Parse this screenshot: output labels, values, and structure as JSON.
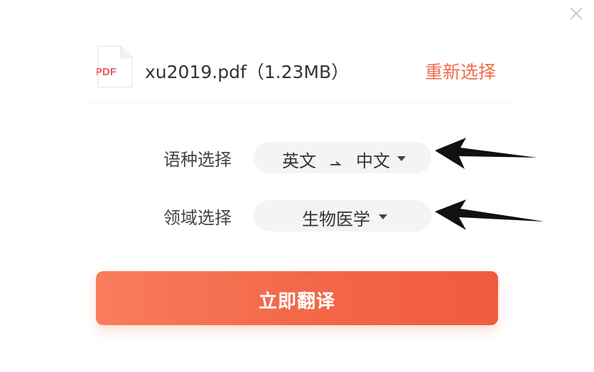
{
  "file": {
    "type_badge": "PDF",
    "name_with_size": "xu2019.pdf（1.23MB）",
    "reselect_label": "重新选择"
  },
  "form": {
    "language": {
      "label": "语种选择",
      "source": "英文",
      "target": "中文"
    },
    "domain": {
      "label": "领域选择",
      "value": "生物医学"
    }
  },
  "actions": {
    "translate_label": "立即翻译"
  },
  "icons": {
    "close": "close-icon",
    "file": "pdf-file-icon",
    "swap": "direction-arrow-icon",
    "dropdown": "caret-down-icon",
    "annotation": "pointer-arrow-icon"
  },
  "colors": {
    "accent": "#f26b4f",
    "button_start": "#f97c5d",
    "button_end": "#f15a40",
    "pill_bg": "#f4f4f6",
    "badge": "#e85a5a"
  }
}
